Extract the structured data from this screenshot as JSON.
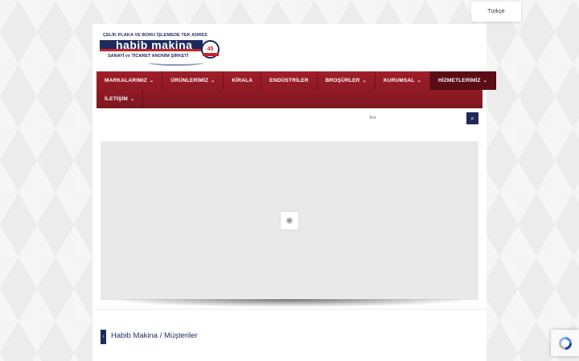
{
  "language": {
    "selected": "Türkçe"
  },
  "logo": {
    "tagline": "ÇELİK PLAKA VE BORU İŞLEMEDE TEK ADRES",
    "name": "habib makina",
    "subtitle": "SANAYİ ve TİCARET ANONİM ŞİRKETİ",
    "badge": "45"
  },
  "nav": {
    "row1": [
      {
        "label": "MARKALARIMIZ",
        "dropdown": true
      },
      {
        "label": "ÜRÜNLERİMİZ",
        "dropdown": true
      },
      {
        "label": "KİRALA",
        "dropdown": false
      },
      {
        "label": "ENDÜSTRİLER",
        "dropdown": false
      },
      {
        "label": "BROŞÜRLER",
        "dropdown": true
      },
      {
        "label": "KURUMSAL",
        "dropdown": true
      },
      {
        "label": "HİZMETLERİMİZ",
        "dropdown": true,
        "active": true
      }
    ],
    "row2": [
      {
        "label": "İLETİŞİM",
        "dropdown": true
      }
    ]
  },
  "search": {
    "placeholder": "Ara"
  },
  "breadcrumb": {
    "home": "Habib Makina",
    "separator": " / ",
    "current": "Müşteriler"
  },
  "colors": {
    "brand_navy": "#1f2a5c",
    "brand_red": "#a01e2a"
  }
}
